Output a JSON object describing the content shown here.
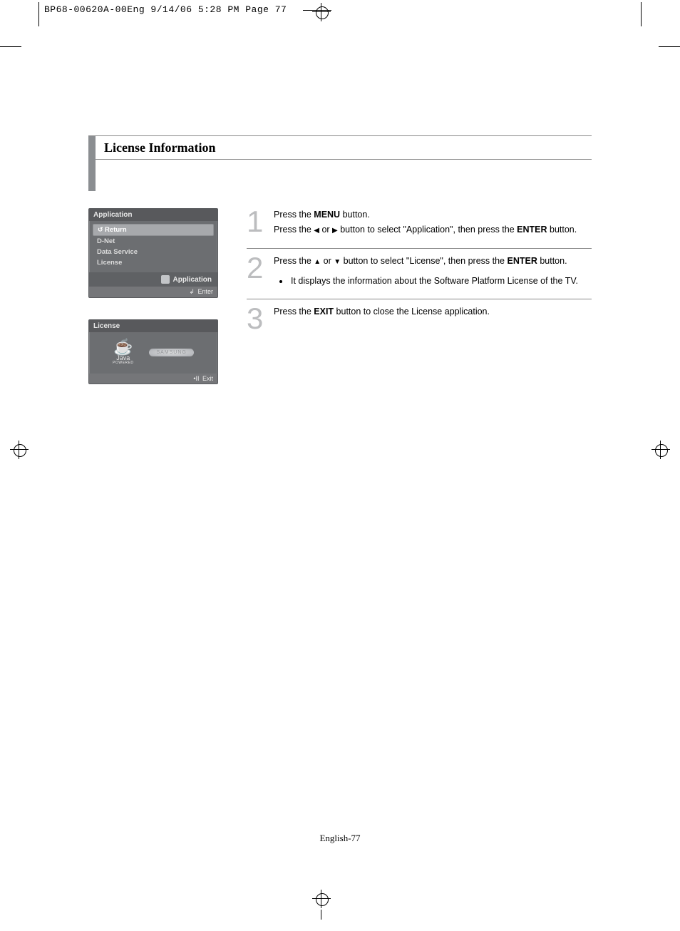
{
  "slug": "BP68-00620A-00Eng  9/14/06  5:28 PM  Page 77",
  "title": "License Information",
  "menu1": {
    "title": "Application",
    "return": "Return",
    "items": [
      "D-Net",
      "Data Service",
      "License"
    ],
    "app_label": "Application",
    "footer_label": "Enter",
    "footer_sym": "↲"
  },
  "menu2": {
    "title": "License",
    "java_name": "Java",
    "java_sub": "POWERED",
    "samsung": "SAMSUNG",
    "footer_label": "Exit",
    "footer_sym": "•II"
  },
  "steps": {
    "s1": {
      "n": "1",
      "l1_a": "Press the ",
      "l1_b": "MENU",
      "l1_c": " button.",
      "l2_a": "Press the ",
      "l2_b": " or ",
      "l2_c": " button to select \"Application\", then press the ",
      "l2_d": "ENTER",
      "l2_e": " button."
    },
    "s2": {
      "n": "2",
      "l1_a": "Press the ",
      "l1_b": " or ",
      "l1_c": " button to select \"License\", then press the ",
      "l1_d": "ENTER",
      "l1_e": " button.",
      "bullet": "It displays the information about the Software Platform License of the TV."
    },
    "s3": {
      "n": "3",
      "l1_a": "Press the ",
      "l1_b": "EXIT",
      "l1_c": " button to close the License application."
    }
  },
  "glyph": {
    "left": "◀",
    "right": "▶",
    "up": "▲",
    "down": "▼"
  },
  "page_num": "English-77"
}
